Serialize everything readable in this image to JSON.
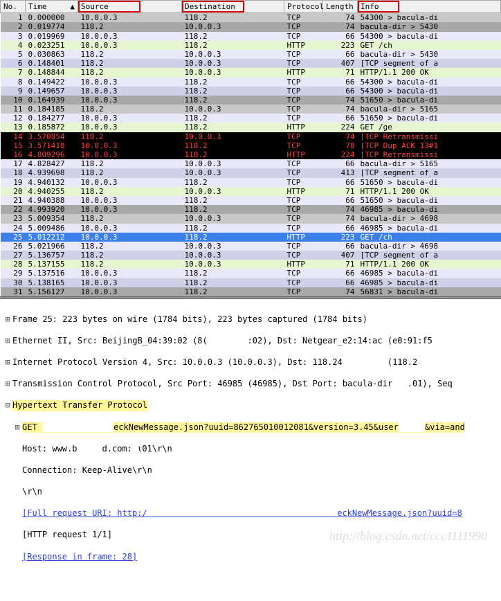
{
  "columns": {
    "no": "No.",
    "time": "Time",
    "source": "Source",
    "destination": "Destination",
    "protocol": "Protocol",
    "length": "Length",
    "info": "Info"
  },
  "rows": [
    {
      "no": 1,
      "time": "0.000000",
      "src": "10.0.0.3",
      "dst": "118.2",
      "proto": "TCP",
      "len": 74,
      "info": "54300 > bacula-di",
      "cls": "row-grey"
    },
    {
      "no": 2,
      "time": "0.019774",
      "src": "118.2",
      "dst": "10.0.0.3",
      "proto": "TCP",
      "len": 74,
      "info": "bacula-dir > 5430",
      "cls": "row-greyd"
    },
    {
      "no": 3,
      "time": "0.019969",
      "src": "10.0.0.3",
      "dst": "118.2",
      "proto": "TCP",
      "len": 66,
      "info": "54300 > bacula-di",
      "cls": "row-lav"
    },
    {
      "no": 4,
      "time": "0.023251",
      "src": "10.0.0.3",
      "dst": "118.2",
      "proto": "HTTP",
      "len": 223,
      "info": "GET             /ch",
      "cls": "row-green"
    },
    {
      "no": 5,
      "time": "0.030863",
      "src": "118.2",
      "dst": "10.0.0.3",
      "proto": "TCP",
      "len": 66,
      "info": "bacula-dir > 5430",
      "cls": "row-lav"
    },
    {
      "no": 6,
      "time": "0.148401",
      "src": "118.2",
      "dst": "10.0.0.3",
      "proto": "TCP",
      "len": 407,
      "info": "[TCP segment of a",
      "cls": "row-lavd"
    },
    {
      "no": 7,
      "time": "0.148844",
      "src": "118.2",
      "dst": "10.0.0.3",
      "proto": "HTTP",
      "len": 71,
      "info": "HTTP/1.1 200 OK",
      "cls": "row-green"
    },
    {
      "no": 8,
      "time": "0.149422",
      "src": "10.0.0.3",
      "dst": "118.2",
      "proto": "TCP",
      "len": 66,
      "info": "54300 > bacula-di",
      "cls": "row-lav"
    },
    {
      "no": 9,
      "time": "0.149657",
      "src": "10.0.0.3",
      "dst": "118.2",
      "proto": "TCP",
      "len": 66,
      "info": "54300 > bacula-di",
      "cls": "row-lavd"
    },
    {
      "no": 10,
      "time": "0.164939",
      "src": "10.0.0.3",
      "dst": "118.2",
      "proto": "TCP",
      "len": 74,
      "info": "51650 > bacula-di",
      "cls": "row-greyd"
    },
    {
      "no": 11,
      "time": "0.184185",
      "src": "118.2",
      "dst": "10.0.0.3",
      "proto": "TCP",
      "len": 74,
      "info": "bacula-dir > 5165",
      "cls": "row-grey"
    },
    {
      "no": 12,
      "time": "0.184277",
      "src": "10.0.0.3",
      "dst": "118.2",
      "proto": "TCP",
      "len": 66,
      "info": "51650 > bacula-di",
      "cls": "row-lav"
    },
    {
      "no": 13,
      "time": "0.185872",
      "src": "10.0.0.3",
      "dst": "118.2",
      "proto": "HTTP",
      "len": 224,
      "info": "GET           /ge",
      "cls": "row-green"
    },
    {
      "no": 14,
      "time": "3.570854",
      "src": "118.2",
      "dst": "10.0.0.3",
      "proto": "TCP",
      "len": 74,
      "info": "[TCP Retransmissi",
      "cls": "row-dark"
    },
    {
      "no": 15,
      "time": "3.571418",
      "src": "10.0.0.3",
      "dst": "118.2",
      "proto": "TCP",
      "len": 78,
      "info": "[TCP Dup ACK 13#1",
      "cls": "row-dark"
    },
    {
      "no": 16,
      "time": "4.809296",
      "src": "10.0.0.3",
      "dst": "118.2",
      "proto": "HTTP",
      "len": 224,
      "info": "[TCP Retransmissi",
      "cls": "row-dark"
    },
    {
      "no": 17,
      "time": "4.828427",
      "src": "118.2",
      "dst": "10.0.0.3",
      "proto": "TCP",
      "len": 66,
      "info": "bacula-dir > 5165",
      "cls": "row-lav"
    },
    {
      "no": 18,
      "time": "4.939698",
      "src": "118.2",
      "dst": "10.0.0.3",
      "proto": "TCP",
      "len": 413,
      "info": "[TCP segment of a",
      "cls": "row-lavd"
    },
    {
      "no": 19,
      "time": "4.940132",
      "src": "10.0.0.3",
      "dst": "118.2",
      "proto": "TCP",
      "len": 66,
      "info": "51650 > bacula-di",
      "cls": "row-lav"
    },
    {
      "no": 20,
      "time": "4.940255",
      "src": "118.2",
      "dst": "10.0.0.3",
      "proto": "HTTP",
      "len": 71,
      "info": "HTTP/1.1 200 OK",
      "cls": "row-green"
    },
    {
      "no": 21,
      "time": "4.940388",
      "src": "10.0.0.3",
      "dst": "118.2",
      "proto": "TCP",
      "len": 66,
      "info": "51650 > bacula-di",
      "cls": "row-lav"
    },
    {
      "no": 22,
      "time": "4.993920",
      "src": "10.0.0.3",
      "dst": "118.2",
      "proto": "TCP",
      "len": 74,
      "info": "46985 > bacula-di",
      "cls": "row-greyd"
    },
    {
      "no": 23,
      "time": "5.009354",
      "src": "118.2",
      "dst": "10.0.0.3",
      "proto": "TCP",
      "len": 74,
      "info": "bacula-dir > 4698",
      "cls": "row-grey"
    },
    {
      "no": 24,
      "time": "5.009486",
      "src": "10.0.0.3",
      "dst": "118.2",
      "proto": "TCP",
      "len": 66,
      "info": "46985 > bacula-di",
      "cls": "row-lav"
    },
    {
      "no": 25,
      "time": "5.012212",
      "src": "10.0.0.3",
      "dst": "118.2",
      "proto": "HTTP",
      "len": 223,
      "info": "GET             /ch",
      "cls": "row-sel"
    },
    {
      "no": 26,
      "time": "5.021966",
      "src": "118.2",
      "dst": "10.0.0.3",
      "proto": "TCP",
      "len": 66,
      "info": "bacula-dir > 4698",
      "cls": "row-lav"
    },
    {
      "no": 27,
      "time": "5.136757",
      "src": "118.2",
      "dst": "10.0.0.3",
      "proto": "TCP",
      "len": 407,
      "info": "[TCP segment of a",
      "cls": "row-lavd"
    },
    {
      "no": 28,
      "time": "5.137155",
      "src": "118.2",
      "dst": "10.0.0.3",
      "proto": "HTTP",
      "len": 71,
      "info": "HTTP/1.1 200 OK",
      "cls": "row-green"
    },
    {
      "no": 29,
      "time": "5.137516",
      "src": "10.0.0.3",
      "dst": "118.2",
      "proto": "TCP",
      "len": 66,
      "info": "46985 > bacula-di",
      "cls": "row-lav"
    },
    {
      "no": 30,
      "time": "5.138165",
      "src": "10.0.0.3",
      "dst": "118.2",
      "proto": "TCP",
      "len": 66,
      "info": "46985 > bacula-di",
      "cls": "row-lavd"
    },
    {
      "no": 31,
      "time": "5.156127",
      "src": "10.0.0.3",
      "dst": "118.2",
      "proto": "TCP",
      "len": 74,
      "info": "56831 > bacula-di",
      "cls": "row-greyd"
    }
  ],
  "detail": {
    "frame": "Frame 25: 223 bytes on wire (1784 bits), 223 bytes captured (1784 bits)",
    "eth": "Ethernet II, Src: BeijingB_04:39:02 (8(        :02), Dst: Netgear_e2:14:ac (e0:91:f5",
    "ip": "Internet Protocol Version 4, Src: 10.0.0.3 (10.0.0.3), Dst: 118.24         (118.2",
    "tcp": "Transmission Control Protocol, Src Port: 46985 (46985), Dst Port: bacula-dir   .01), Seq",
    "http_hdr": "Hypertext Transfer Protocol",
    "get_a": "GET ",
    "get_b": "eckNewMessage.json?uuid=862765010012081&version=3.45&user",
    "get_c": "&via=and",
    "host": "Host: www.b     d.com: ι01\\r\\n",
    "conn": "Connection: Keep-Alive\\r\\n",
    "crlf": "\\r\\n",
    "full_a": "[Full request URI: http:/",
    "full_b": "eckNewMessage.json?uuid=8",
    "reqnum": "[HTTP request 1/1]",
    "resp": "[Response in frame: 28]"
  },
  "watermark": "http://blog.csdn.net/ccc1111990"
}
